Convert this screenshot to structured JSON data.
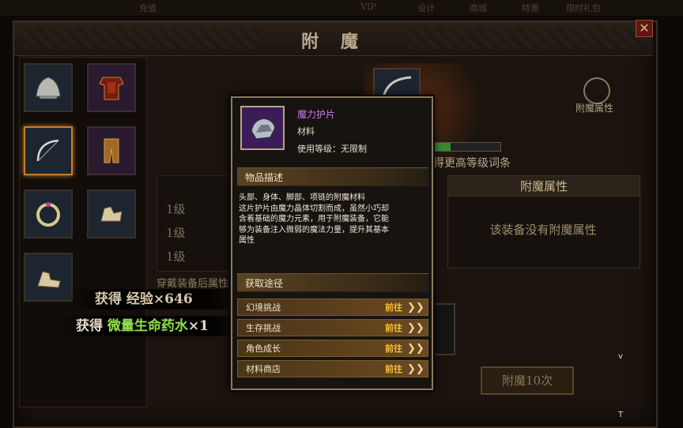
{
  "window": {
    "title": "附 魔",
    "close_label": "✕"
  },
  "top_menu": [
    "充值",
    "VIP",
    "设计",
    "商城",
    "特惠",
    "限时礼包"
  ],
  "equipment_slots": [
    {
      "icon": "helmet-icon"
    },
    {
      "icon": "chest-armor-icon"
    },
    {
      "icon": "bow-icon",
      "selected": true
    },
    {
      "icon": "pants-icon"
    },
    {
      "icon": "ring-icon"
    },
    {
      "icon": "gloves-icon"
    },
    {
      "icon": "boots-icon"
    }
  ],
  "rewards": {
    "exp": "获得 经验×646",
    "potion_prefix": "获得 ",
    "potion_name": "微量生命药水",
    "potion_count": "×1"
  },
  "enchant_panel": {
    "property_button": "附魔属性",
    "upgrade_hint_partial": "得更高等级词条",
    "attr_header": "附魔属性",
    "attr_empty": "该装备没有附魔属性",
    "levels": [
      "1级",
      "1级",
      "1级"
    ],
    "wear_note": "穿戴装备后属性",
    "enchant_10_button": "附魔10次"
  },
  "tooltip": {
    "item_name": "魔力护片",
    "item_type": "材料",
    "use_level": "使用等级：无限制",
    "desc_title": "物品描述",
    "desc_lines": [
      "头部、身体、脚部、项链的附魔材料",
      "这片护片由魔力晶体切割而成，虽然小巧却",
      "含着基础的魔力元素，用于附魔装备，它能",
      "够为装备注入微弱的魔法力量，提升其基本",
      "属性"
    ],
    "source_title": "获取途径",
    "sources": [
      {
        "label": "幻境挑战",
        "action": "前往"
      },
      {
        "label": "生存挑战",
        "action": "前往"
      },
      {
        "label": "角色成长",
        "action": "前往"
      },
      {
        "label": "材料商店",
        "action": "前往"
      }
    ],
    "arrow_glyph": "❯❯"
  },
  "cursor_marks": [
    "v",
    "T"
  ],
  "colors": {
    "item_name": "#c87ef0",
    "go_label": "#f6c233",
    "potion_name": "#8fe04a"
  }
}
